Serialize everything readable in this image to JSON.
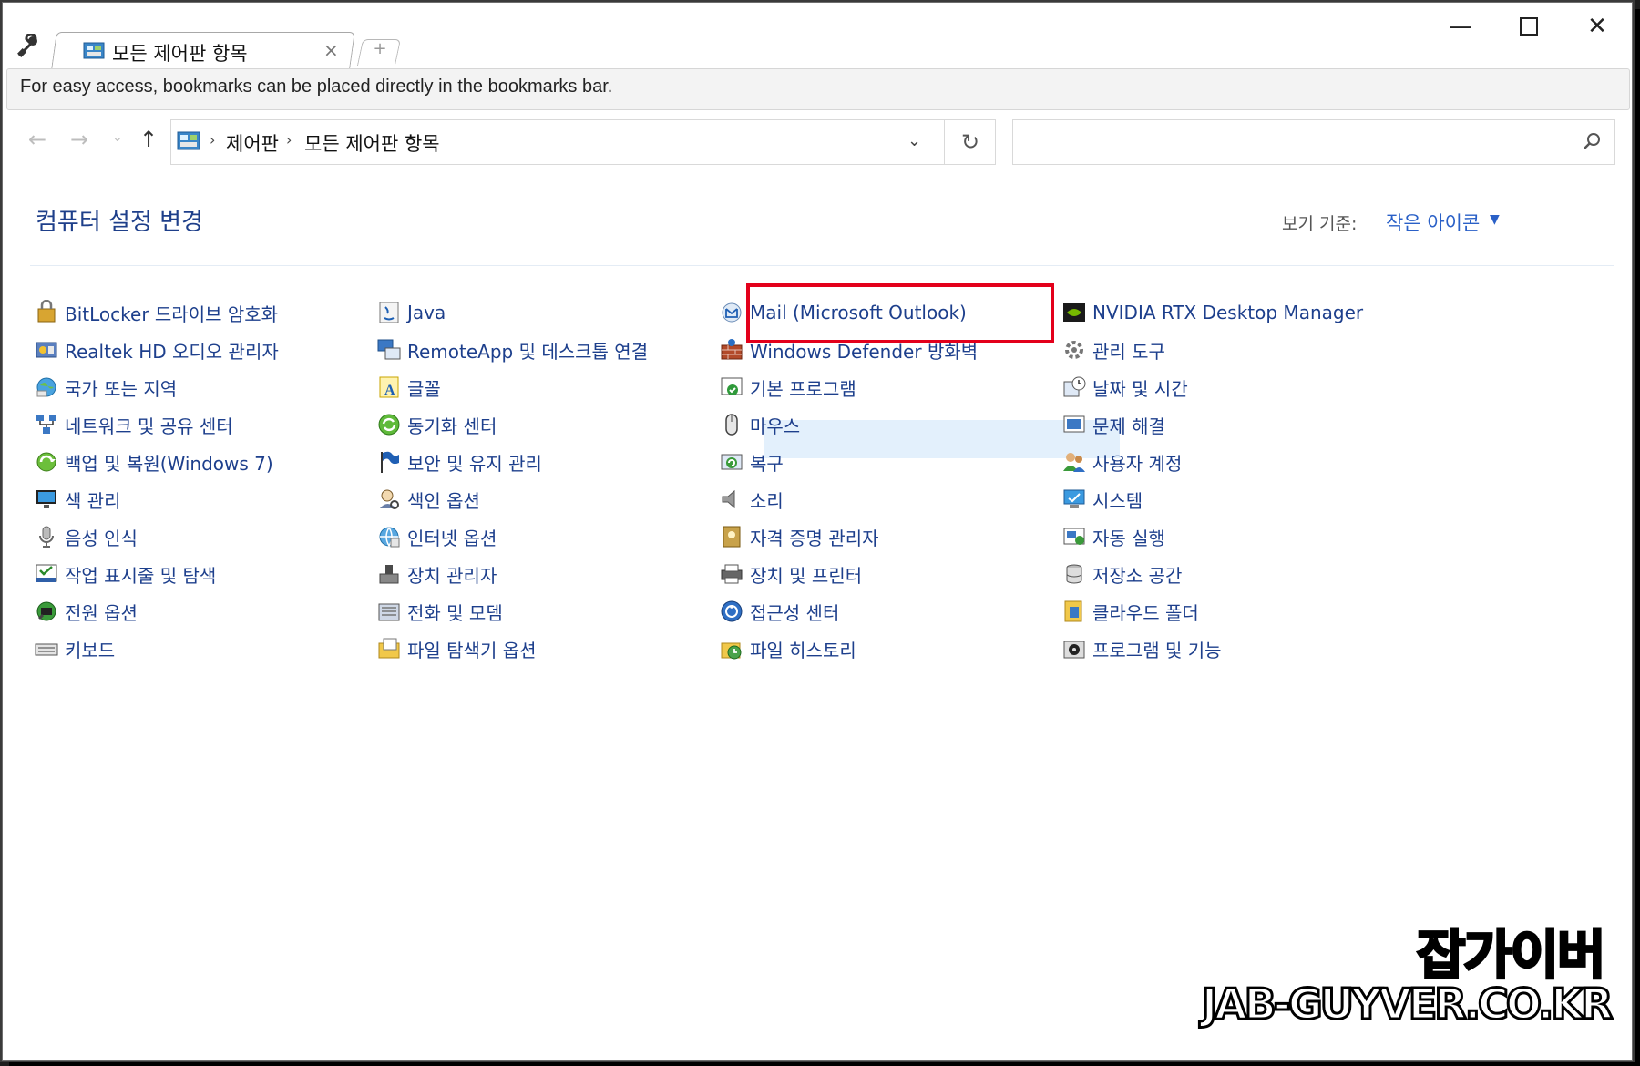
{
  "browser": {
    "tab_title": "모든 제어판 항목",
    "tab_close": "×",
    "new_tab": "+",
    "bookmark_hint": "For easy access, bookmarks can be placed directly in the bookmarks bar.",
    "window_min": "—",
    "window_close": "✕"
  },
  "address": {
    "crumbs": [
      "제어판",
      "모든 제어판 항목"
    ],
    "separator": "›",
    "search_value": ""
  },
  "page": {
    "title": "컴퓨터 설정 변경",
    "view_by_label": "보기 기준:",
    "view_by_value": "작은 아이콘",
    "highlight_color": "#e3f0fc",
    "callout_color": "#e3001b"
  },
  "columns": [
    {
      "items": [
        {
          "label": "BitLocker 드라이브 암호화",
          "icon": "bitlocker-icon"
        },
        {
          "label": "Realtek HD 오디오 관리자",
          "icon": "audio-manager-icon"
        },
        {
          "label": "국가 또는 지역",
          "icon": "region-icon"
        },
        {
          "label": "네트워크 및 공유 센터",
          "icon": "network-icon"
        },
        {
          "label": "백업 및 복원(Windows 7)",
          "icon": "backup-icon"
        },
        {
          "label": "색 관리",
          "icon": "color-management-icon"
        },
        {
          "label": "음성 인식",
          "icon": "microphone-icon"
        },
        {
          "label": "작업 표시줄 및 탐색",
          "icon": "taskbar-icon"
        },
        {
          "label": "전원 옵션",
          "icon": "power-icon"
        },
        {
          "label": "키보드",
          "icon": "keyboard-icon"
        }
      ]
    },
    {
      "items": [
        {
          "label": "Java",
          "icon": "java-icon"
        },
        {
          "label": "RemoteApp 및 데스크톱 연결",
          "icon": "remoteapp-icon"
        },
        {
          "label": "글꼴",
          "icon": "font-icon"
        },
        {
          "label": "동기화 센터",
          "icon": "sync-icon"
        },
        {
          "label": "보안 및 유지 관리",
          "icon": "flag-icon"
        },
        {
          "label": "색인 옵션",
          "icon": "indexing-icon"
        },
        {
          "label": "인터넷 옵션",
          "icon": "internet-options-icon"
        },
        {
          "label": "장치 관리자",
          "icon": "device-manager-icon"
        },
        {
          "label": "전화 및 모뎀",
          "icon": "phone-modem-icon"
        },
        {
          "label": "파일 탐색기 옵션",
          "icon": "folder-options-icon"
        }
      ]
    },
    {
      "items": [
        {
          "label": "Mail (Microsoft Outlook)",
          "icon": "mail-icon"
        },
        {
          "label": "Windows Defender 방화벽",
          "icon": "firewall-icon"
        },
        {
          "label": "기본 프로그램",
          "icon": "default-programs-icon"
        },
        {
          "label": "마우스",
          "icon": "mouse-icon"
        },
        {
          "label": "복구",
          "icon": "recovery-icon"
        },
        {
          "label": "소리",
          "icon": "speaker-icon"
        },
        {
          "label": "자격 증명 관리자",
          "icon": "credential-icon"
        },
        {
          "label": "장치 및 프린터",
          "icon": "printer-icon"
        },
        {
          "label": "접근성 센터",
          "icon": "accessibility-icon"
        },
        {
          "label": "파일 히스토리",
          "icon": "file-history-icon"
        }
      ]
    },
    {
      "items": [
        {
          "label": "NVIDIA RTX Desktop Manager",
          "icon": "nvidia-icon"
        },
        {
          "label": "관리 도구",
          "icon": "admin-tools-icon"
        },
        {
          "label": "날짜 및 시간",
          "icon": "clock-icon"
        },
        {
          "label": "문제 해결",
          "icon": "troubleshoot-icon"
        },
        {
          "label": "사용자 계정",
          "icon": "user-accounts-icon"
        },
        {
          "label": "시스템",
          "icon": "system-icon"
        },
        {
          "label": "자동 실행",
          "icon": "autoplay-icon"
        },
        {
          "label": "저장소 공간",
          "icon": "storage-icon"
        },
        {
          "label": "클라우드 폴더",
          "icon": "cloud-folder-icon"
        },
        {
          "label": "프로그램 및 기능",
          "icon": "programs-icon"
        }
      ]
    }
  ],
  "watermark": {
    "line1": "잡가이버",
    "line2": "JAB-GUYVER.CO.KR"
  }
}
